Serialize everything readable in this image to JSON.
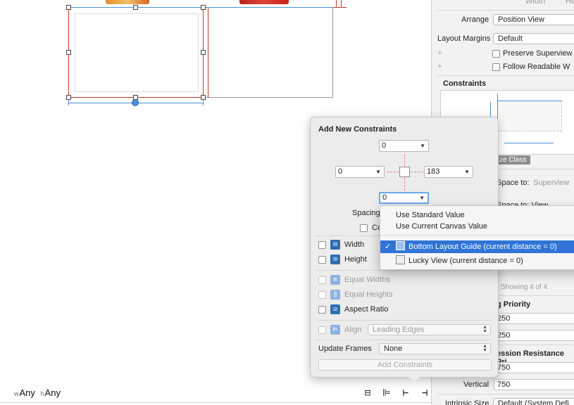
{
  "canvas": {
    "size_class": {
      "w_prefix": "w",
      "w_value": "Any",
      "h_prefix": "h",
      "h_value": "Any"
    },
    "tools": [
      {
        "name": "stack-tool",
        "glyph": "⊟"
      },
      {
        "name": "align-tool",
        "glyph": "⊫"
      },
      {
        "name": "pin-tool",
        "glyph": "⊢"
      },
      {
        "name": "resolve-tool",
        "glyph": "⊣"
      }
    ]
  },
  "inspector": {
    "header_width": "Width",
    "header_height": "He",
    "arrange_label": "Arrange",
    "arrange_value": "Position View",
    "layout_margins_label": "Layout Margins",
    "layout_margins_value": "Default",
    "preserve_superview": "Preserve Superview",
    "follow_readable": "Follow Readable W",
    "constraints_title": "Constraints",
    "size_class_chip": "ze Class",
    "space_to_superview_label": "Space to:",
    "space_to_superview_value": "Superview",
    "space_to_view": "Space to:  View",
    "showing": "Showing 4 of 4",
    "hugging_title": "g Priority",
    "hugging_h": "250",
    "hugging_v": "250",
    "compression_title": "ession Resistance Pri",
    "compression_h": "750",
    "vertical_label": "Vertical",
    "compression_v": "750",
    "intrinsic_label": "Intrinsic Size",
    "intrinsic_value": "Default (System Defi"
  },
  "popover": {
    "title": "Add New Constraints",
    "top_value": "0",
    "leading_value": "0",
    "trailing_value": "183",
    "bottom_value": "0",
    "spacing_label": "Spacing",
    "constrain_margins_label": "Co",
    "width_label": "Width",
    "height_label": "Height",
    "equal_widths_label": "Equal Widths",
    "equal_heights_label": "Equal Heights",
    "aspect_ratio_label": "Aspect Ratio",
    "align_label": "Align",
    "align_value": "Leading Edges",
    "update_frames_label": "Update Frames",
    "update_frames_value": "None",
    "add_button": "Add Constraints"
  },
  "menu": {
    "items": [
      "Use Standard Value",
      "Use Current Canvas Value",
      "Bottom Layout Guide (current distance = 0)",
      "Lucky View (current distance = 0)"
    ],
    "selected_check": "✓"
  },
  "colors": {
    "selection": "#c0392b",
    "accent_blue": "#2f74d6",
    "guide_blue": "#4a90d9"
  }
}
